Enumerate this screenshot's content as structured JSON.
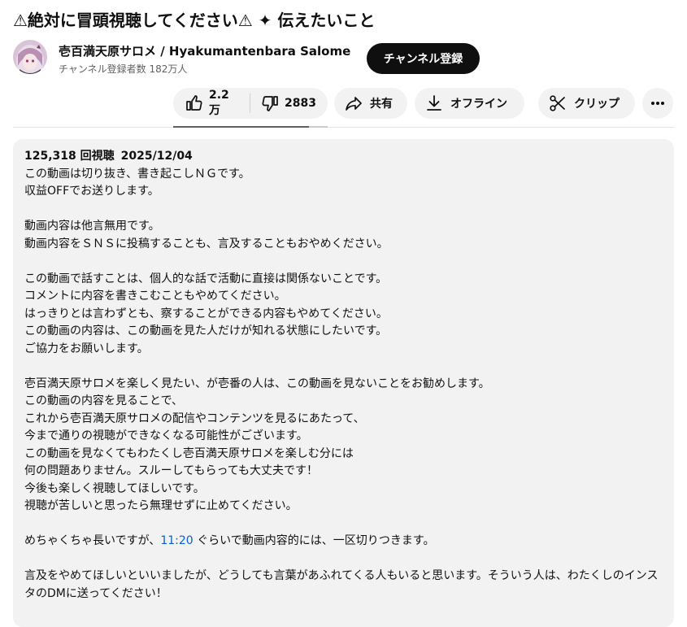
{
  "video": {
    "title": "⚠絶対に冒頭視聴してください⚠ ✦ 伝えたいこと"
  },
  "channel": {
    "name": "壱百満天原サロメ / Hyakumantenbara Salome",
    "subscribers": "チャンネル登録者数 182万人",
    "subscribe_label": "チャンネル登録",
    "avatar_icon": "avatar-salome"
  },
  "actions": {
    "likes": "2.2万",
    "dislikes": "2883",
    "like_ratio": 0.88,
    "share_label": "共有",
    "offline_label": "オフライン",
    "clip_label": "クリップ"
  },
  "description": {
    "views": "125,318 回視聴",
    "date": "2025/12/04",
    "lines": [
      "この動画は切り抜き、書き起こしＮＧです。",
      "収益OFFでお送りします。",
      "",
      "動画内容は他言無用です。",
      "動画内容をＳＮＳに投稿することも、言及することもおやめください。",
      "",
      "この動画で話すことは、個人的な話で活動に直接は関係ないことです。",
      "コメントに内容を書きこむこともやめてください。",
      "はっきりとは言わずとも、察することができる内容もやめてください。",
      "この動画の内容は、この動画を見た人だけが知れる状態にしたいです。",
      "ご協力をお願いします。",
      "",
      "壱百満天原サロメを楽しく見たい、が壱番の人は、この動画を見ないことをお勧めします。",
      "この動画の内容を見ることで、",
      "これから壱百満天原サロメの配信やコンテンツを見るにあたって、",
      "今まで通りの視聴ができなくなる可能性がございます。",
      "この動画を見なくてもわたくし壱百満天原サロメを楽しむ分には",
      "何の問題ありません。スルーしてもらっても大丈夫です！",
      "今後も楽しく視聴してほしいです。",
      "視聴が苦しいと思ったら無理せずに止めてください。",
      ""
    ],
    "timestamp_line": {
      "before": "めちゃくちゃ長いですが、",
      "timestamp": "11:20",
      "after": " ぐらいで動画内容的には、一区切りつきます。"
    },
    "closing": "言及をやめてほしいといいましたが、どうしても言葉があふれてくる人もいると思います。そういう人は、わたくしのインスタのDMに送ってください！"
  },
  "colors": {
    "link": "#065fd4",
    "pill_bg": "#f2f2f2",
    "subscribe_bg": "#0f0f0f"
  }
}
